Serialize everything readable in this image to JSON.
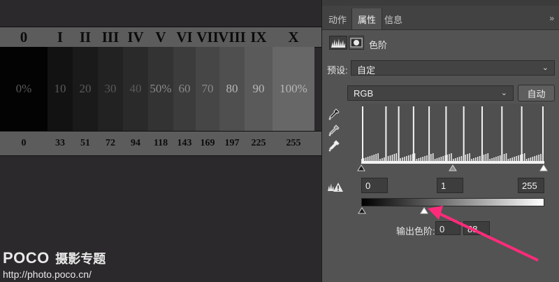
{
  "canvas": {
    "roman_labels": [
      "0",
      "I",
      "II",
      "III",
      "IV",
      "V",
      "VI",
      "VII",
      "VIII",
      "IX",
      "X"
    ],
    "percent_labels": [
      "0%",
      "10",
      "20",
      "30",
      "40",
      "50%",
      "60",
      "70",
      "80",
      "90",
      "100%"
    ],
    "values": [
      "0",
      "33",
      "51",
      "72",
      "94",
      "118",
      "143",
      "169",
      "197",
      "225",
      "255"
    ],
    "colors": [
      "#030303",
      "#131213",
      "#1b1a1b",
      "#232223",
      "#2b2a2b",
      "#343334",
      "#3d3c3d",
      "#474647",
      "#504f50",
      "#5b5a5b",
      "#686768"
    ]
  },
  "watermark": {
    "brand": "POCO",
    "title": "摄影专题",
    "url": "http://photo.poco.cn/"
  },
  "panel": {
    "tabs": [
      "动作",
      "属性",
      "信息"
    ],
    "active_tab": "属性",
    "collapse": "»",
    "adjustment_title": "色阶",
    "preset_label": "预设:",
    "preset_value": "自定",
    "channel_value": "RGB",
    "auto_button": "自动",
    "input_black": "0",
    "input_gamma": "1",
    "input_white": "255",
    "output_label": "输出色阶:",
    "output_black": "0",
    "output_white": "88",
    "annotation_color": "#ff2b7a"
  }
}
